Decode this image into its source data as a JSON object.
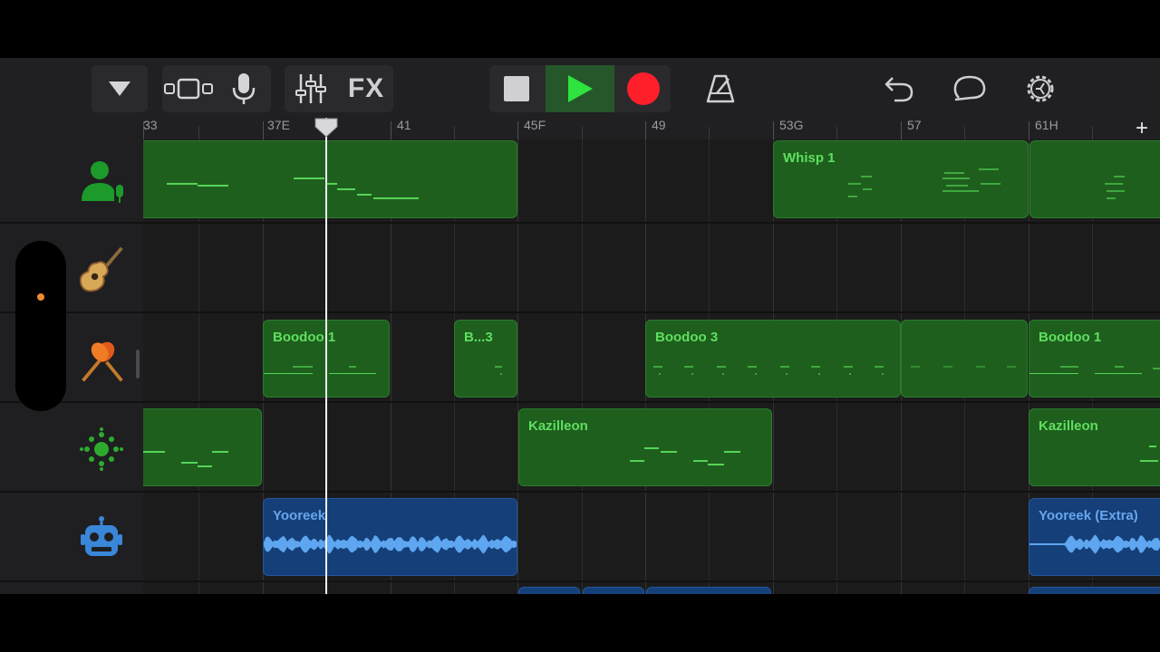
{
  "toolbar": {
    "fx_label": "FX",
    "icons": [
      "tracks-dropdown-icon",
      "view-toggle-icon",
      "microphone-icon",
      "mixer-icon",
      "fx",
      "stop-icon",
      "play-icon",
      "record-icon",
      "metronome-icon",
      "undo-icon",
      "loop-icon",
      "settings-icon"
    ],
    "colors": {
      "play": "#2ee33e",
      "record": "#ff1f2a",
      "play_bg": "#25572b"
    }
  },
  "ruler": {
    "bars": [
      {
        "label": "33"
      },
      {
        "label": "37E"
      },
      {
        "label": "41"
      },
      {
        "label": "45F"
      },
      {
        "label": "49"
      },
      {
        "label": "53G"
      },
      {
        "label": "57"
      },
      {
        "label": "61H"
      }
    ],
    "add_label": "+"
  },
  "tracks": [
    {
      "icon": "voice-track-icon",
      "regions": [
        {
          "label": ""
        },
        {
          "label": "Whisp 1"
        },
        {
          "label": ""
        }
      ]
    },
    {
      "icon": "acoustic-guitar-icon",
      "regions": []
    },
    {
      "icon": "maracas-icon",
      "regions": [
        {
          "label": "Boodoo 1"
        },
        {
          "label": "B...3"
        },
        {
          "label": "Boodoo 3"
        },
        {
          "label": ""
        },
        {
          "label": "Boodoo 1"
        }
      ]
    },
    {
      "icon": "drum-machine-icon",
      "regions": [
        {
          "label": ""
        },
        {
          "label": "Kazilleon"
        },
        {
          "label": "Kazilleon"
        }
      ]
    },
    {
      "icon": "robot-icon",
      "regions": [
        {
          "label": "Yooreek"
        },
        {
          "label": "Yooreek (Extra)"
        }
      ]
    }
  ],
  "colors": {
    "midi_region": "#1e5f1e",
    "audio_region": "#153f78",
    "region_text_green": "#5fdf5f",
    "region_text_blue": "#67a6ee",
    "volume_dot": "#f08a30"
  }
}
